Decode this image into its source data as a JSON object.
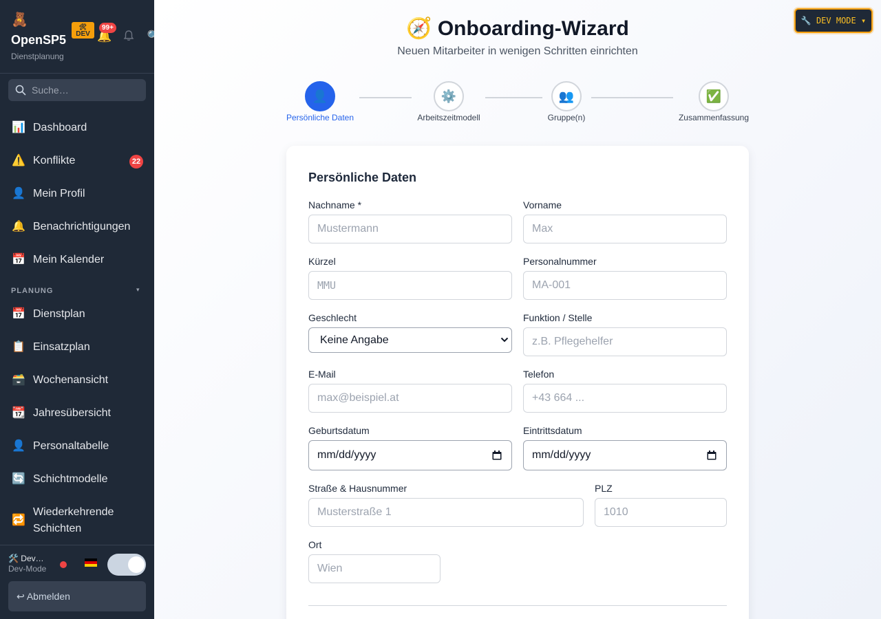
{
  "sidebar": {
    "app_name": "OpenSP5",
    "app_subtitle": "Dienstplanung",
    "dev_badge": "DEV",
    "dev_badge_icon": "🛠",
    "notification_count": "99+",
    "search_placeholder": "Suche…",
    "items": [
      {
        "icon": "📊",
        "label": "Dashboard"
      },
      {
        "icon": "⚠️",
        "label": "Konflikte",
        "badge": "22"
      },
      {
        "icon": "👤",
        "label": "Mein Profil"
      },
      {
        "icon": "🔔",
        "label": "Benachrichtigungen"
      },
      {
        "icon": "📅",
        "label": "Mein Kalender"
      }
    ],
    "section_title": "PLANUNG",
    "section_chevron": "▾",
    "planning_items": [
      {
        "icon": "📅",
        "label": "Dienstplan"
      },
      {
        "icon": "📋",
        "label": "Einsatzplan"
      },
      {
        "icon": "🗃️",
        "label": "Wochenansicht"
      },
      {
        "icon": "📆",
        "label": "Jahresübersicht"
      },
      {
        "icon": "👤",
        "label": "Personaltabelle"
      },
      {
        "icon": "🔄",
        "label": "Schichtmodelle"
      },
      {
        "icon": "🔁",
        "label": "Wiederkehrende Schichten"
      }
    ],
    "footer": {
      "user_name": "🛠️ Dev…",
      "user_role": "Dev-Mode",
      "flag": "🇩🇪",
      "logout_label": "↩ Abmelden"
    }
  },
  "header_icons": {
    "search": "🔍",
    "help": "?",
    "book": "📖",
    "compass": "🧭"
  },
  "dev_mode_button": "🔧 DEV MODE ▾",
  "page": {
    "title_icon": "🧭",
    "title": "Onboarding-Wizard",
    "subtitle": "Neuen Mitarbeiter in wenigen Schritten einrichten"
  },
  "steps": [
    {
      "icon": "👤",
      "label": "Persönliche Daten",
      "active": true
    },
    {
      "icon": "⚙️",
      "label": "Arbeitszeitmodell",
      "active": false
    },
    {
      "icon": "👥",
      "label": "Gruppe(n)",
      "active": false
    },
    {
      "icon": "✅",
      "label": "Zusammenfassung",
      "active": false
    }
  ],
  "form": {
    "title": "Persönliche Daten",
    "nachname": {
      "label": "Nachname *",
      "placeholder": "Mustermann"
    },
    "vorname": {
      "label": "Vorname",
      "placeholder": "Max"
    },
    "kuerzel": {
      "label": "Kürzel",
      "placeholder": "MMU"
    },
    "personalnummer": {
      "label": "Personalnummer",
      "placeholder": "MA-001"
    },
    "geschlecht": {
      "label": "Geschlecht",
      "value": "Keine Angabe"
    },
    "funktion": {
      "label": "Funktion / Stelle",
      "placeholder": "z.B. Pflegehelfer"
    },
    "email": {
      "label": "E-Mail",
      "placeholder": "max@beispiel.at"
    },
    "telefon": {
      "label": "Telefon",
      "placeholder": "+43 664 ..."
    },
    "geburtsdatum": {
      "label": "Geburtsdatum",
      "value": "mm/dd/yyyy"
    },
    "eintrittsdatum": {
      "label": "Eintrittsdatum",
      "value": "mm/dd/yyyy"
    },
    "strasse": {
      "label": "Straße & Hausnummer",
      "placeholder": "Musterstraße 1"
    },
    "plz": {
      "label": "PLZ",
      "placeholder": "1010"
    },
    "ort": {
      "label": "Ort",
      "placeholder": "Wien"
    }
  },
  "colors": {
    "sidebar_bg": "#1f2937",
    "accent": "#2563eb",
    "dev_accent": "#f59e0b",
    "badge": "#ef4444"
  }
}
